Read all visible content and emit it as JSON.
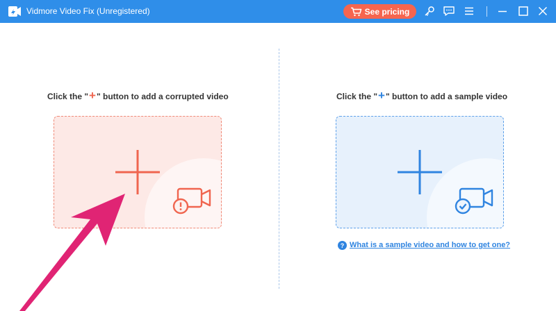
{
  "window": {
    "title": "Vidmore Video Fix (Unregistered)",
    "pricing_label": "See pricing",
    "icons": [
      "app-icon",
      "cart-icon",
      "key-icon",
      "chat-icon",
      "menu-icon",
      "minimize-icon",
      "maximize-icon",
      "close-icon"
    ]
  },
  "left": {
    "caption_pre": "Click the \"",
    "caption_plus": "+",
    "caption_post": "\" button to add a corrupted video",
    "accent": "#f0654f"
  },
  "right": {
    "caption_pre": "Click the \"",
    "caption_plus": "+",
    "caption_post": "\" button to add a sample video",
    "accent": "#2f84e0",
    "help_icon_text": "?",
    "help_link": "What is a sample video and how to get one?"
  },
  "annotation": {
    "arrow_color": "#e02474"
  }
}
